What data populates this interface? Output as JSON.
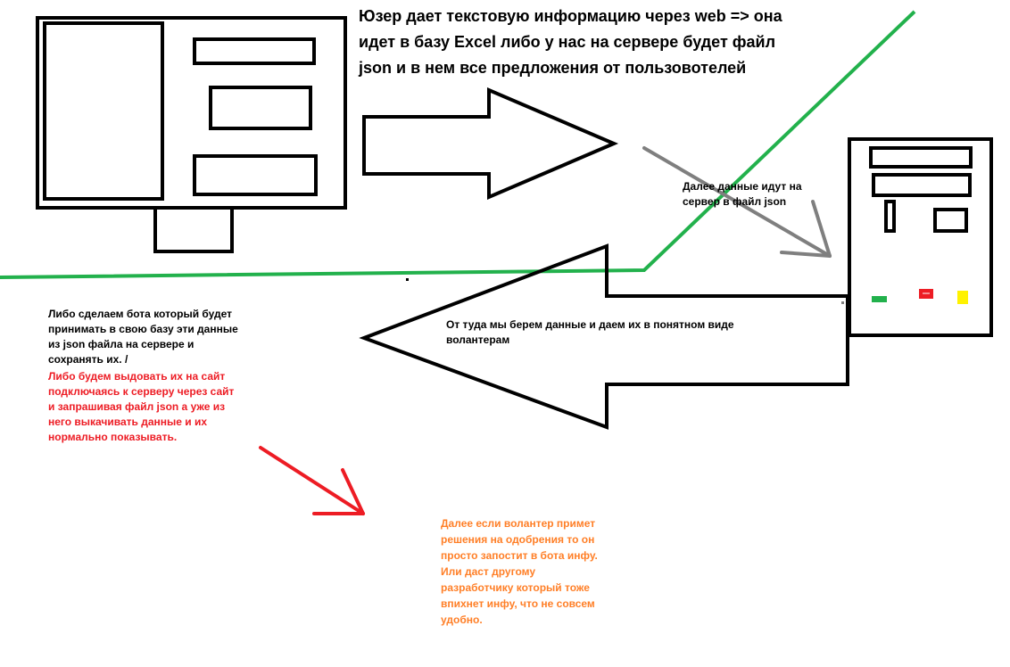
{
  "colors": {
    "outline": "#000000",
    "green_line": "#22b14c",
    "gray_arrow": "#7f7f7f",
    "red_text": "#ed1c24",
    "orange_text": "#ff7f27",
    "server_led_green": "#22b14c",
    "server_led_red": "#ed1c24",
    "server_led_yellow": "#fff200"
  },
  "notes": {
    "title": "Юзер дает текстовую информацию через web => она\nидет в базу Excel либо у нас на сервере будет файл\njson и в нем все предложения от пользовотелей",
    "server_flow": "Далее данные идут на\nсервер в файл json",
    "return_flow": "От туда мы берем данные и даем их в понятном виде\nволантерам",
    "bot_option": "Либо сделаем бота который будет\nпринимать в свою базу эти данные\nиз json файла на сервере и\nсохранять их. /",
    "site_option": "Либо будем выдовать их на сайт\nподключаясь к серверу через сайт\nи запрашивая файл json а уже из\nнего выкачивать данные и их\nнормально показывать.",
    "volunteer_step": "Далее если волантер примет\nрешения на одобрения то он\nпросто запостит в бота инфу.\nИли даст другому\nразработчику который тоже\nвпихнет инфу, что не совсем\nудобно."
  },
  "elements": {
    "monitor": "monitor-icon",
    "server": "server-icon",
    "forward_arrow": "arrow-right-outline",
    "return_arrow": "arrow-left-outline",
    "server_arrow": "arrow-down-right-gray",
    "red_arrow": "arrow-down-right-red"
  }
}
